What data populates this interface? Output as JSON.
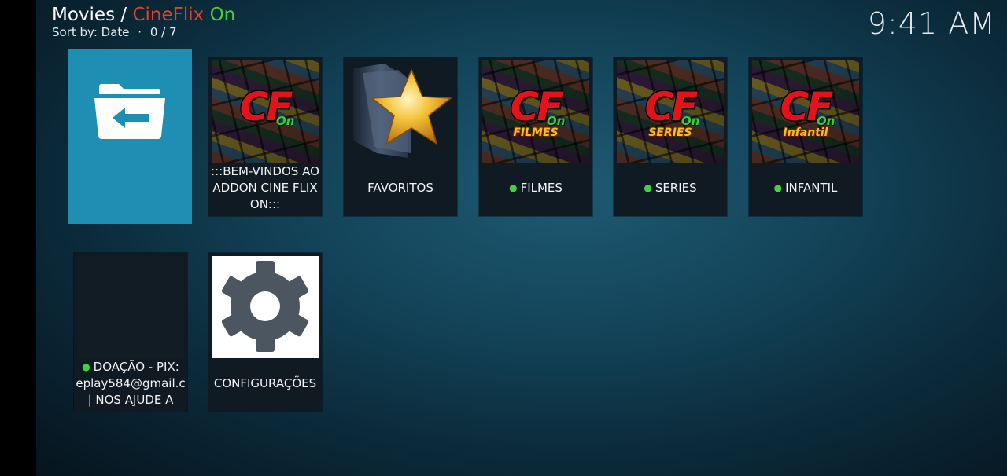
{
  "header": {
    "section": "Movies",
    "separator": " / ",
    "addon_name_part1": "CineFlix",
    "addon_name_part2": "On",
    "sort_label": "Sort by: Date",
    "dot": "·",
    "position": "0 / 7"
  },
  "clock": "9:41 AM",
  "colors": {
    "accent_red": "#e2412c",
    "accent_green": "#3fd13f",
    "back_tile": "#1f8eb3"
  },
  "tiles": [
    {
      "icon": "back-folder-icon"
    },
    {
      "label": ":::BEM-VINDOS AO ADDON CINE FLIX ON:::",
      "logo": "CF",
      "logo_on": "On",
      "logo_sub": ""
    },
    {
      "label": "FAVORITOS",
      "icon": "star-folder-icon"
    },
    {
      "label": "FILMES",
      "logo": "CF",
      "logo_on": "On",
      "logo_sub": "FILMES"
    },
    {
      "label": "SERIES",
      "logo": "CF",
      "logo_on": "On",
      "logo_sub": "SERIES"
    },
    {
      "label": "INFANTIL",
      "logo": "CF",
      "logo_on": "On",
      "logo_sub": "Infantil"
    },
    {
      "label_line1": "DOAÇÃO - PIX:",
      "label_line2": "eplay584@gmail.c",
      "label_line3": "| NOS AJUDE A"
    },
    {
      "label": "CONFIGURAÇÕES",
      "icon": "gear-icon"
    }
  ],
  "bullet": "●"
}
